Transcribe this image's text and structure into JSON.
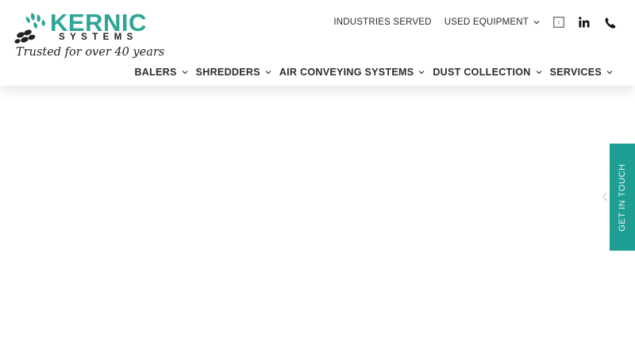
{
  "brand": {
    "name": "KERNIC",
    "subname": "SYSTEMS",
    "tagline": "Trusted for over 40 years",
    "primary_color": "#2ea597",
    "tab_color": "#1f9e93"
  },
  "top_nav": {
    "items": [
      {
        "label": "INDUSTRIES SERVED",
        "has_dropdown": false
      },
      {
        "label": "USED EQUIPMENT",
        "has_dropdown": true
      }
    ],
    "icons": [
      "document-icon",
      "linkedin-icon",
      "phone-icon"
    ]
  },
  "main_nav": {
    "items": [
      {
        "label": "BALERS"
      },
      {
        "label": "SHREDDERS"
      },
      {
        "label": "AIR CONVEYING SYSTEMS"
      },
      {
        "label": "DUST COLLECTION"
      },
      {
        "label": "SERVICES"
      }
    ]
  },
  "side_tab": {
    "label": "GET IN TOUCH"
  }
}
